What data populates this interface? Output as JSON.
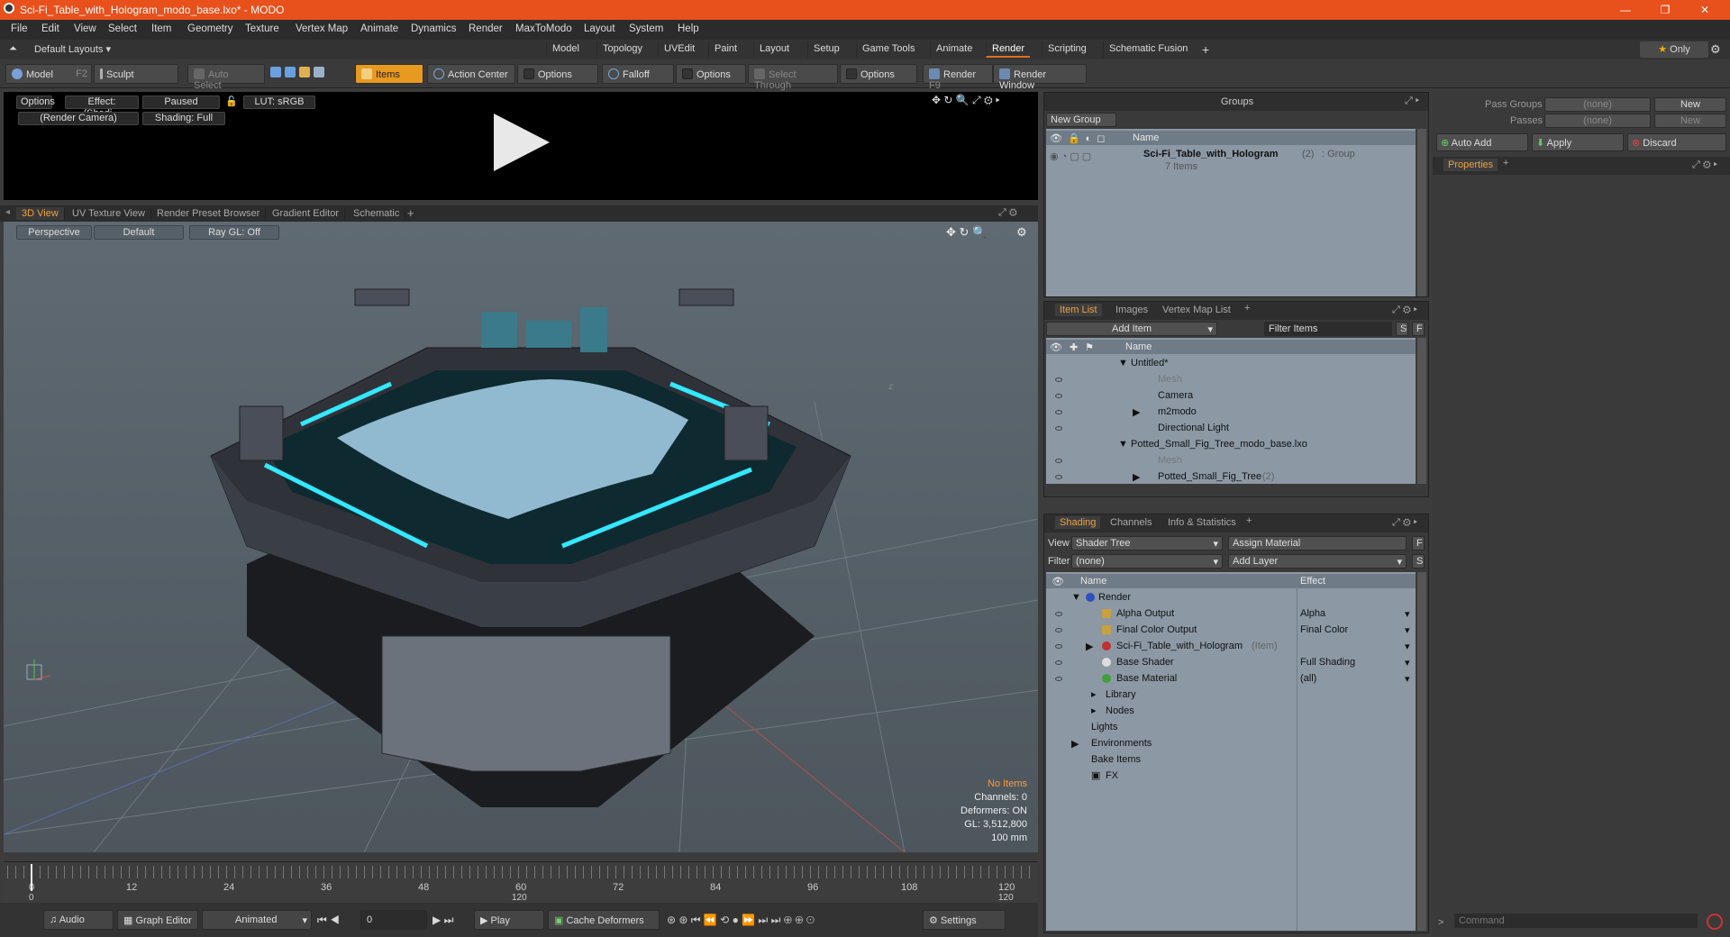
{
  "title": "Sci-Fi_Table_with_Hologram_modo_base.lxo* - MODO",
  "menu": [
    "File",
    "Edit",
    "View",
    "Select",
    "Item",
    "Geometry",
    "Texture",
    "Vertex Map",
    "Animate",
    "Dynamics",
    "Render",
    "MaxToModo",
    "Layout",
    "System",
    "Help"
  ],
  "layouts_label": "Default Layouts ▾",
  "layout_tabs": [
    "Model",
    "Topology",
    "UVEdit",
    "Paint",
    "Layout",
    "Setup",
    "Game Tools",
    "Animate",
    "Render",
    "Scripting",
    "Schematic Fusion"
  ],
  "active_layout": "Render",
  "only_label": "Only",
  "toolbar": {
    "model": "Model",
    "model_key": "F2",
    "sculpt": "Sculpt",
    "auto_select": "Auto Select",
    "items": "Items",
    "action_center": "Action Center",
    "options1": "Options",
    "falloff": "Falloff",
    "options2": "Options",
    "select_through": "Select Through",
    "options3": "Options",
    "render": "Render",
    "render_key": "F9",
    "render_window": "Render Window"
  },
  "render_preview": {
    "options": "Options",
    "effect": "Effect: (Shadi...",
    "paused": "Paused",
    "lut": "LUT: sRGB",
    "camera": "(Render Camera)",
    "shading": "Shading: Full"
  },
  "viewport_tabs": [
    "3D View",
    "UV Texture View",
    "Render Preset Browser",
    "Gradient Editor",
    "Schematic"
  ],
  "viewport": {
    "perspective": "Perspective",
    "default": "Default",
    "raygl": "Ray GL: Off",
    "info": [
      "No Items",
      "Channels: 0",
      "Deformers: ON",
      "GL: 3,512,800",
      "100 mm"
    ],
    "axis_label": "z",
    "accent": "#ff9a3a",
    "neon": "#33e8ff"
  },
  "timeline": {
    "ticks": [
      "0",
      "12",
      "24",
      "36",
      "48",
      "60",
      "72",
      "84",
      "96",
      "108",
      "120"
    ],
    "sub_ticks": [
      "0",
      "120",
      "120"
    ]
  },
  "bottom": {
    "audio": "Audio",
    "graph_editor": "Graph Editor",
    "animated": "Animated",
    "frame": "0",
    "play": "Play",
    "cache": "Cache Deformers",
    "settings": "Settings"
  },
  "groups": {
    "title": "Groups",
    "new_group": "New Group",
    "col_name": "Name",
    "item": "Sci-Fi_Table_with_Hologram",
    "item_count": "(2)",
    "item_type": ": Group",
    "item_sub": "7 Items"
  },
  "itemlist": {
    "tabs": [
      "Item List",
      "Images",
      "Vertex Map List"
    ],
    "add_item": "Add Item",
    "filter": "Filter Items",
    "col_name": "Name",
    "rows": [
      {
        "label": "Untitled*",
        "indent": 0,
        "dim": false
      },
      {
        "label": "Mesh",
        "indent": 2,
        "dim": true
      },
      {
        "label": "Camera",
        "indent": 2,
        "dim": false
      },
      {
        "label": "m2modo",
        "indent": 2,
        "dim": false
      },
      {
        "label": "Directional Light",
        "indent": 2,
        "dim": false
      },
      {
        "label": "Potted_Small_Fig_Tree_modo_base.lxo",
        "indent": 0,
        "dim": false
      },
      {
        "label": "Mesh",
        "indent": 2,
        "dim": true
      },
      {
        "label": "Potted_Small_Fig_Tree",
        "extra": "(2)",
        "indent": 2,
        "dim": false
      }
    ]
  },
  "shading": {
    "tabs": [
      "Shading",
      "Channels",
      "Info & Statistics"
    ],
    "view_label": "View",
    "view_value": "Shader Tree",
    "assign": "Assign Material",
    "filter_label": "Filter",
    "filter_value": "(none)",
    "add_layer": "Add Layer",
    "col_name": "Name",
    "col_effect": "Effect",
    "rows": [
      {
        "label": "Render",
        "effect": "",
        "indent": 0
      },
      {
        "label": "Alpha Output",
        "effect": "Alpha",
        "indent": 1
      },
      {
        "label": "Final Color Output",
        "effect": "Final Color",
        "indent": 1
      },
      {
        "label": "Sci-Fi_Table_with_Hologram",
        "extra": "(Item)",
        "effect": "",
        "indent": 1
      },
      {
        "label": "Base Shader",
        "effect": "Full Shading",
        "indent": 1
      },
      {
        "label": "Base Material",
        "effect": "(all)",
        "indent": 1
      },
      {
        "label": "Library",
        "effect": "",
        "indent": 1
      },
      {
        "label": "Nodes",
        "effect": "",
        "indent": 1
      },
      {
        "label": "Lights",
        "effect": "",
        "indent": 0
      },
      {
        "label": "Environments",
        "effect": "",
        "indent": 0
      },
      {
        "label": "Bake Items",
        "effect": "",
        "indent": 0
      },
      {
        "label": "FX",
        "effect": "",
        "indent": 0
      }
    ]
  },
  "right": {
    "pass_groups": "Pass Groups",
    "passes": "Passes",
    "none": "(none)",
    "new": "New",
    "auto_add": "Auto Add",
    "apply": "Apply",
    "discard": "Discard",
    "properties": "Properties",
    "command": "Command"
  }
}
